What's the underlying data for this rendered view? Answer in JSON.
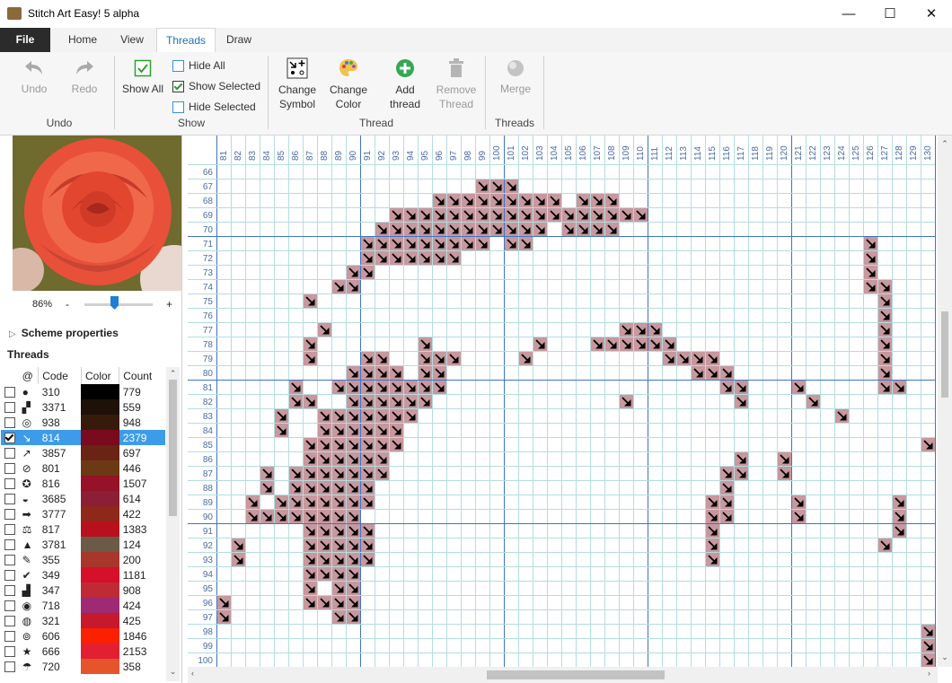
{
  "window": {
    "title": "Stitch Art Easy! 5 alpha",
    "minimize": "—",
    "maximize": "☐",
    "close": "✕"
  },
  "menu": {
    "file": "File",
    "tabs": [
      "Home",
      "View",
      "Threads",
      "Draw"
    ],
    "active_tab": "Threads"
  },
  "ribbon": {
    "undo": "Undo",
    "redo": "Redo",
    "undo_group": "Undo",
    "show_all": "Show All",
    "hide_all": "Hide All",
    "show_selected": "Show Selected",
    "hide_selected": "Hide Selected",
    "show_group": "Show",
    "change_symbol": [
      "Change",
      "Symbol"
    ],
    "change_color": [
      "Change",
      "Color"
    ],
    "add_thread": [
      "Add",
      "thread"
    ],
    "remove_thread": [
      "Remove",
      "Thread"
    ],
    "thread_group": "Thread",
    "merge": "Merge",
    "threads_group": "Threads"
  },
  "left_panel": {
    "zoom_value": "86%",
    "zoom_minus": "-",
    "zoom_plus": "+",
    "scheme_properties": "Scheme properties",
    "threads_heading": "Threads",
    "columns": {
      "symbol": "@",
      "code": "Code",
      "color": "Color",
      "count": "Count"
    },
    "threads": [
      {
        "symbol": "●",
        "code": "310",
        "color": "#000000",
        "count": "779",
        "checked": false
      },
      {
        "symbol": "▞",
        "code": "3371",
        "color": "#1e1108",
        "count": "559",
        "checked": false
      },
      {
        "symbol": "◎",
        "code": "938",
        "color": "#361a0c",
        "count": "948",
        "checked": false
      },
      {
        "symbol": "↘",
        "code": "814",
        "color": "#7a0a1e",
        "count": "2379",
        "checked": true,
        "selected": true
      },
      {
        "symbol": "↗",
        "code": "3857",
        "color": "#6a2416",
        "count": "697",
        "checked": false
      },
      {
        "symbol": "⊘",
        "code": "801",
        "color": "#6b3a15",
        "count": "446",
        "checked": false
      },
      {
        "symbol": "✪",
        "code": "816",
        "color": "#961228",
        "count": "1507",
        "checked": false
      },
      {
        "symbol": "◒",
        "code": "3685",
        "color": "#8c1e35",
        "count": "614",
        "checked": false
      },
      {
        "symbol": "➡",
        "code": "3777",
        "color": "#8e281b",
        "count": "422",
        "checked": false
      },
      {
        "symbol": "⚖",
        "code": "817",
        "color": "#b9101e",
        "count": "1383",
        "checked": false
      },
      {
        "symbol": "▲",
        "code": "3781",
        "color": "#6b5a45",
        "count": "124",
        "checked": false
      },
      {
        "symbol": "✎",
        "code": "355",
        "color": "#a8362b",
        "count": "200",
        "checked": false
      },
      {
        "symbol": "✔",
        "code": "349",
        "color": "#d6102a",
        "count": "1181",
        "checked": false
      },
      {
        "symbol": "▟",
        "code": "347",
        "color": "#bf2a35",
        "count": "908",
        "checked": false
      },
      {
        "symbol": "◉",
        "code": "718",
        "color": "#9e2a74",
        "count": "424",
        "checked": false
      },
      {
        "symbol": "◍",
        "code": "321",
        "color": "#c7192d",
        "count": "425",
        "checked": false
      },
      {
        "symbol": "⊚",
        "code": "606",
        "color": "#fa2000",
        "count": "1846",
        "checked": false
      },
      {
        "symbol": "★",
        "code": "666",
        "color": "#e31f32",
        "count": "2153",
        "checked": false
      },
      {
        "symbol": "☂",
        "code": "720",
        "color": "#e5542a",
        "count": "358",
        "checked": false
      }
    ]
  },
  "grid": {
    "col_start": 81,
    "col_end": 130,
    "row_start": 66,
    "row_end": 100,
    "stitch_color": "#c7989e",
    "stitch_symbol": "↘",
    "stitches": {
      "67": [
        99,
        100,
        101
      ],
      "68": [
        96,
        97,
        98,
        99,
        100,
        101,
        102,
        103,
        104,
        106,
        107,
        108
      ],
      "69": [
        93,
        94,
        95,
        96,
        97,
        98,
        99,
        100,
        101,
        102,
        103,
        104,
        105,
        106,
        107,
        108,
        109,
        110
      ],
      "70": [
        92,
        93,
        94,
        95,
        96,
        97,
        98,
        99,
        100,
        101,
        102,
        103,
        105,
        106,
        107,
        108
      ],
      "71": [
        91,
        92,
        93,
        94,
        95,
        96,
        97,
        98,
        99,
        101,
        102,
        126
      ],
      "72": [
        91,
        92,
        93,
        94,
        95,
        96,
        97,
        126
      ],
      "73": [
        90,
        91,
        126
      ],
      "74": [
        89,
        90,
        126,
        127
      ],
      "75": [
        87,
        127
      ],
      "76": [
        127
      ],
      "77": [
        88,
        109,
        110,
        111,
        127
      ],
      "78": [
        87,
        95,
        103,
        107,
        108,
        109,
        110,
        111,
        112,
        127
      ],
      "79": [
        87,
        91,
        92,
        95,
        96,
        97,
        102,
        112,
        113,
        114,
        115,
        127
      ],
      "80": [
        90,
        91,
        92,
        93,
        95,
        96,
        114,
        115,
        116,
        127
      ],
      "81": [
        86,
        89,
        90,
        91,
        92,
        93,
        94,
        95,
        96,
        116,
        117,
        121,
        127,
        128
      ],
      "82": [
        86,
        87,
        90,
        91,
        92,
        93,
        94,
        95,
        109,
        117,
        122
      ],
      "83": [
        85,
        88,
        89,
        90,
        91,
        92,
        93,
        94,
        124
      ],
      "84": [
        85,
        88,
        89,
        90,
        91,
        92,
        93
      ],
      "85": [
        87,
        88,
        89,
        90,
        91,
        92,
        93,
        130
      ],
      "86": [
        87,
        88,
        89,
        90,
        91,
        92,
        117,
        120
      ],
      "87": [
        84,
        86,
        87,
        88,
        89,
        90,
        91,
        92,
        116,
        117,
        120
      ],
      "88": [
        84,
        86,
        87,
        88,
        89,
        90,
        91,
        116
      ],
      "89": [
        83,
        85,
        86,
        87,
        88,
        89,
        90,
        91,
        115,
        116,
        121,
        128
      ],
      "90": [
        83,
        84,
        85,
        86,
        87,
        88,
        89,
        90,
        115,
        116,
        121,
        128
      ],
      "91": [
        87,
        88,
        89,
        90,
        91,
        115,
        128
      ],
      "92": [
        82,
        87,
        88,
        89,
        90,
        91,
        115,
        127
      ],
      "93": [
        82,
        87,
        88,
        89,
        90,
        91,
        115
      ],
      "94": [
        87,
        88,
        89,
        90
      ],
      "95": [
        87,
        89,
        90
      ],
      "96": [
        81,
        87,
        88,
        89,
        90
      ],
      "97": [
        81,
        89,
        90
      ],
      "98": [
        130
      ],
      "99": [
        130
      ],
      "100": [
        130
      ]
    }
  }
}
